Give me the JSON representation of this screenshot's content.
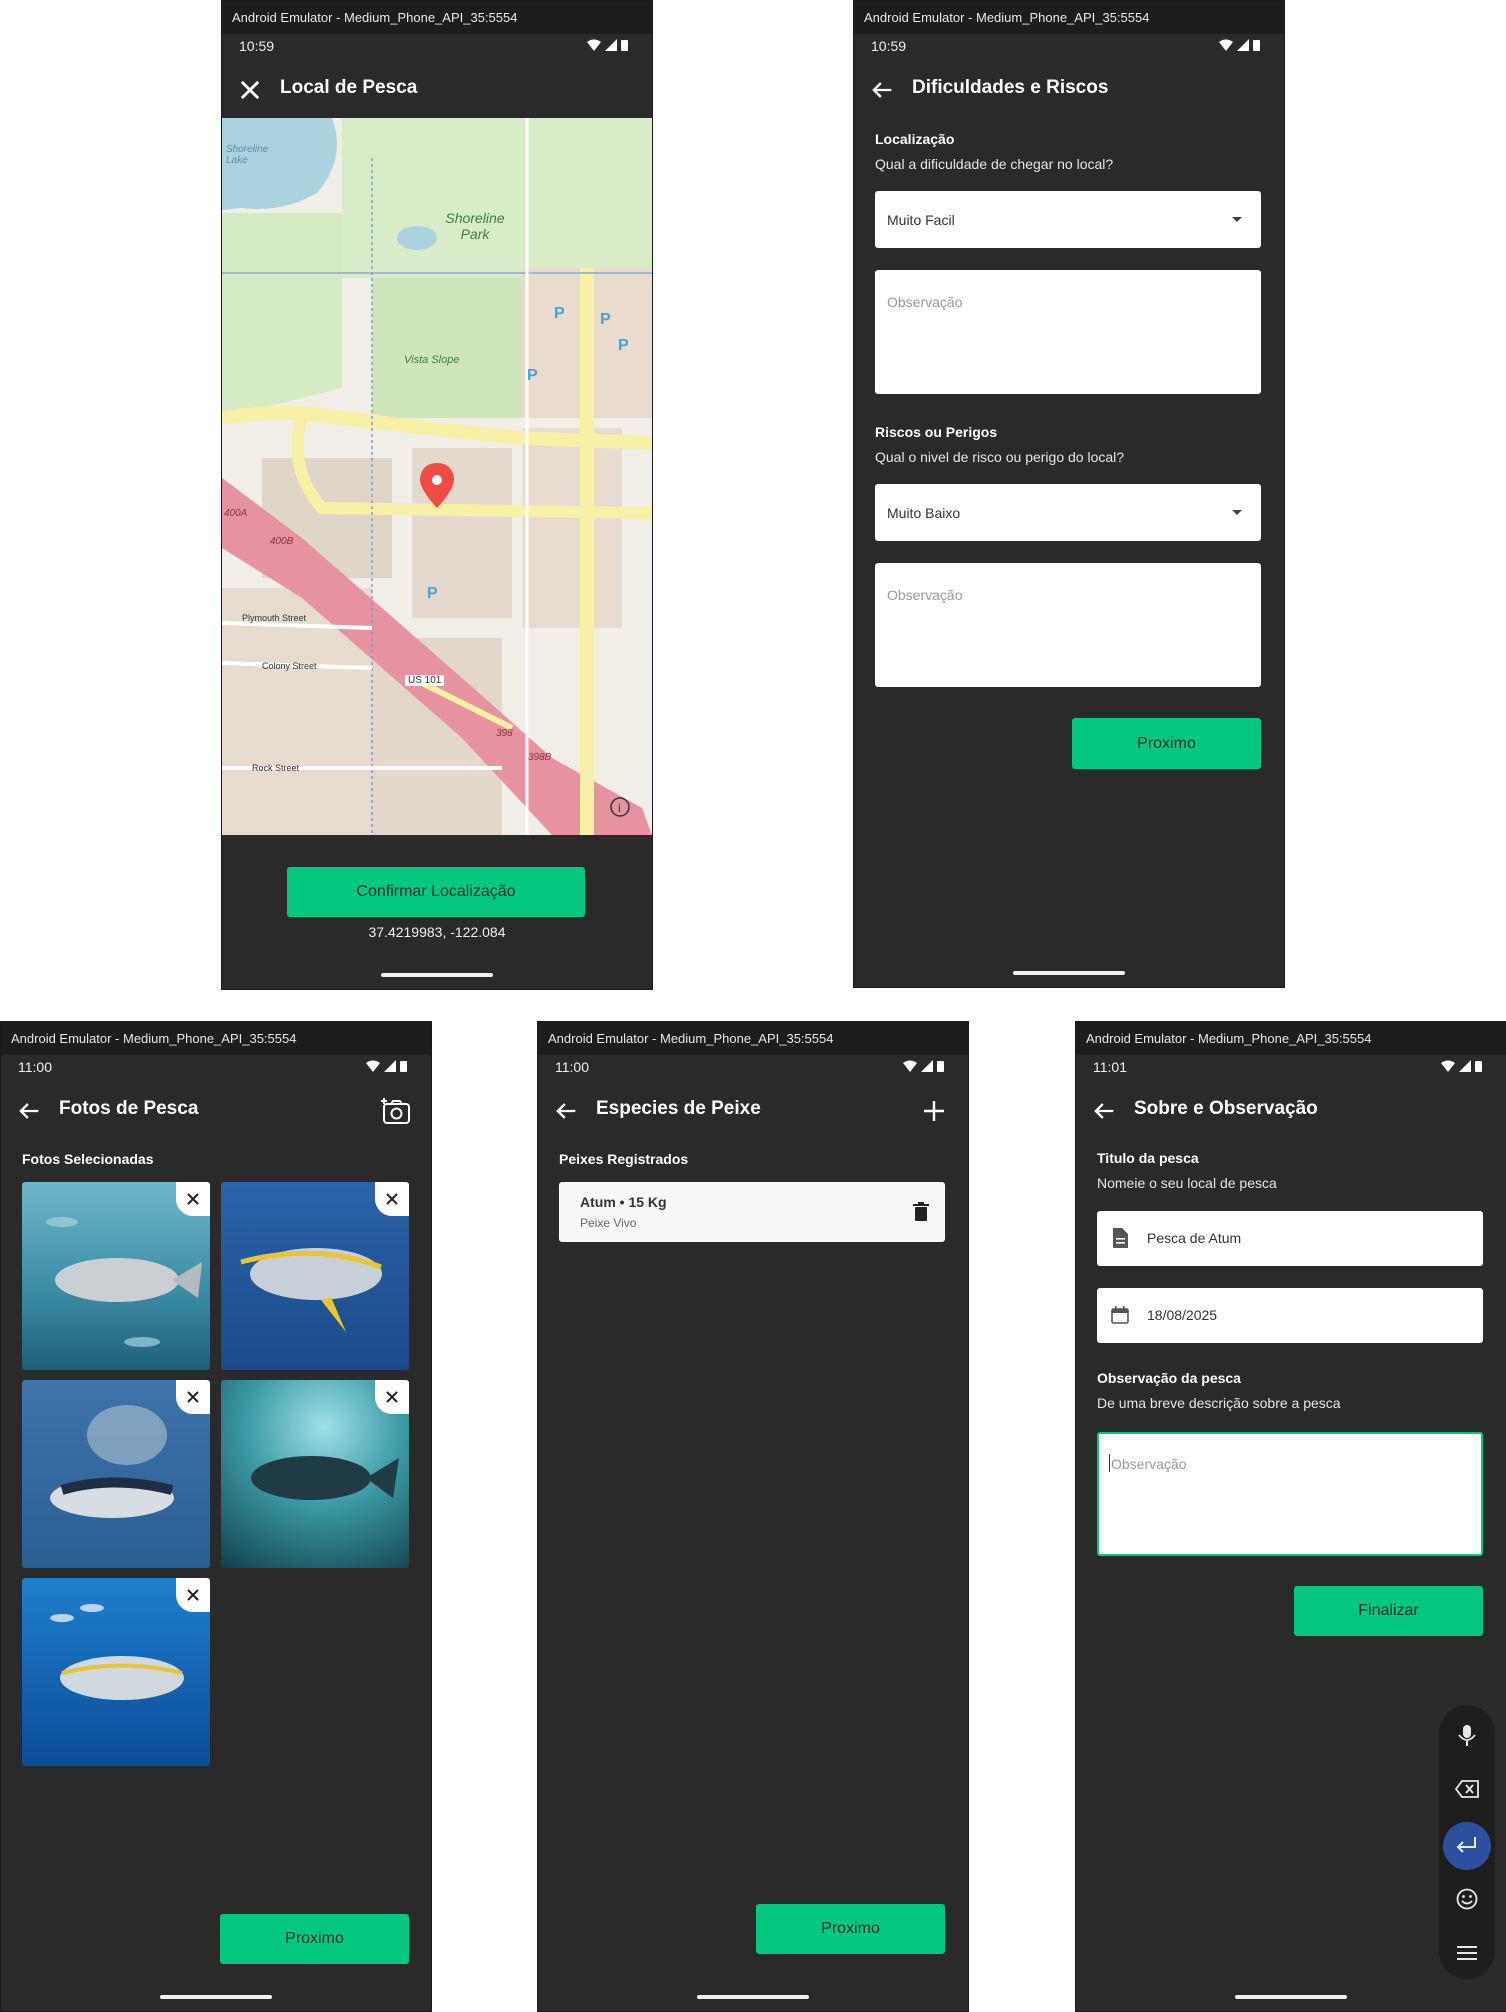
{
  "screens": {
    "map": {
      "window_title": "Android Emulator - Medium_Phone_API_35:5554",
      "time": "10:59",
      "title": "Local de Pesca",
      "confirm_button": "Confirmar Localização",
      "coords": "37.4219983, -122.084",
      "map_labels": {
        "lake": "Shoreline Lake",
        "park": "Shoreline Park",
        "slope": "Vista Slope",
        "plymouth": "Plymouth Street",
        "colony": "Colony Street",
        "us101": "US 101",
        "rock": "Rock Street",
        "route400a": "400A",
        "route400b": "400B",
        "route398": "398",
        "route398b": "398B"
      }
    },
    "risks": {
      "window_title": "Android Emulator - Medium_Phone_API_35:5554",
      "time": "10:59",
      "title": "Dificuldades e Riscos",
      "loc_heading": "Localização",
      "loc_question": "Qual a dificuldade de chegar no local?",
      "loc_select": "Muito Facil",
      "obs_placeholder": "Observação",
      "risk_heading": "Riscos ou Perigos",
      "risk_question": "Qual o nivel de risco ou perigo do local?",
      "risk_select": "Muito Baixo",
      "next_button": "Proximo"
    },
    "photos": {
      "window_title": "Android Emulator - Medium_Phone_API_35:5554",
      "time": "11:00",
      "title": "Fotos de Pesca",
      "heading": "Fotos Selecionadas",
      "next_button": "Proximo"
    },
    "species": {
      "window_title": "Android Emulator - Medium_Phone_API_35:5554",
      "time": "11:00",
      "title": "Especies de Peixe",
      "heading": "Peixes Registrados",
      "fish": [
        {
          "title": "Atum • 15 Kg",
          "subtitle": "Peixe Vivo"
        }
      ],
      "next_button": "Proximo"
    },
    "about": {
      "window_title": "Android Emulator - Medium_Phone_API_35:5554",
      "time": "11:01",
      "title": "Sobre e Observação",
      "title_heading": "Titulo da pesca",
      "title_sub": "Nomeie o seu local de pesca",
      "name_value": "Pesca de Atum",
      "date_value": "18/08/2025",
      "obs_heading": "Observação da pesca",
      "obs_sub": "De uma breve descrição sobre a pesca",
      "obs_placeholder": "Observação",
      "finish_button": "Finalizar"
    }
  },
  "colors": {
    "accent": "#05c880",
    "background": "#2a2a2a",
    "titlebar": "#1d1d1d"
  }
}
